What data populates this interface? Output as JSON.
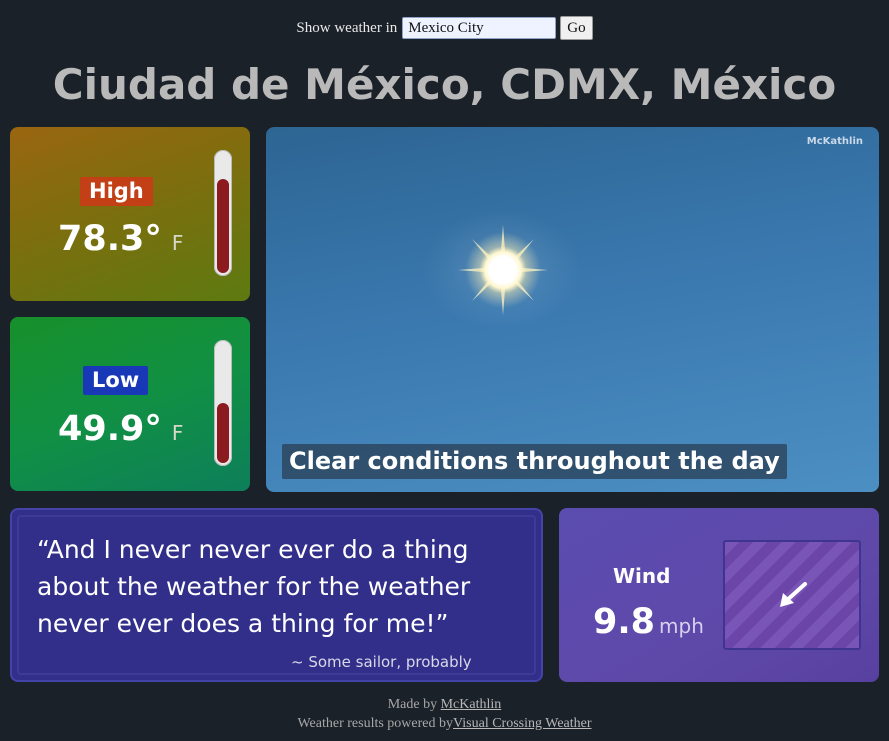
{
  "search": {
    "label": "Show weather in",
    "value": "Mexico City",
    "button_label": "Go"
  },
  "location_title": "Ciudad de México, CDMX, México",
  "high": {
    "label": "High",
    "value": "78.3°",
    "unit": "F",
    "thermometer_level": 0.78,
    "label_color": "#c33f16"
  },
  "low": {
    "label": "Low",
    "value": "49.9°",
    "unit": "F",
    "thermometer_level": 0.5,
    "label_color": "#1838b8"
  },
  "conditions": {
    "watermark": "McKathlin",
    "summary": "Clear conditions throughout the day",
    "icon": "sun-icon"
  },
  "quote": {
    "text": "“And I never never ever do a thing about the weather for the weather never ever does a thing for me!”",
    "attribution": "~ Some sailor, probably"
  },
  "wind": {
    "label": "Wind",
    "value": "9.8",
    "unit": "mph",
    "direction_icon": "arrow-down-left-icon"
  },
  "footer": {
    "made_by_prefix": "Made by",
    "made_by_link": "McKathlin",
    "powered_prefix": "Weather results powered by",
    "powered_link": "Visual Crossing Weather"
  }
}
